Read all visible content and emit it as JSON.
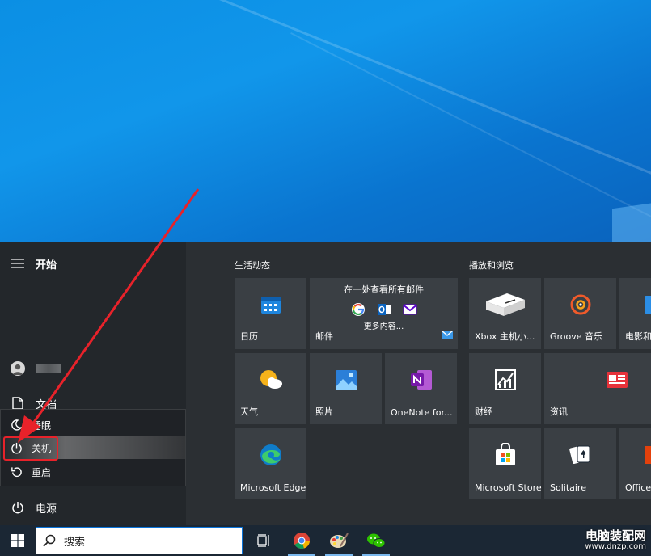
{
  "start_menu": {
    "title": "开始",
    "user_name": "",
    "documents_label": "文档",
    "power_label": "电源"
  },
  "power_menu": {
    "sleep": "睡眠",
    "shutdown": "关机",
    "restart": "重启"
  },
  "groups": {
    "life": "生活动态",
    "play": "播放和浏览"
  },
  "tiles": {
    "calendar": "日历",
    "mail_header": "在一处查看所有邮件",
    "mail_more": "更多内容...",
    "mail": "邮件",
    "weather": "天气",
    "photos": "照片",
    "onenote": "OneNote for...",
    "edge": "Microsoft Edge",
    "xbox": "Xbox 主机小...",
    "groove": "Groove 音乐",
    "movies": "电影和",
    "finance": "财经",
    "news": "资讯",
    "store": "Microsoft Store",
    "solitaire": "Solitaire",
    "office": "Office"
  },
  "taskbar": {
    "search_placeholder": "搜索"
  },
  "watermark": {
    "name": "电脑装配网",
    "url": "www.dnzp.com"
  },
  "colors": {
    "highlight": "#e8222a",
    "accent": "#0a74da"
  }
}
